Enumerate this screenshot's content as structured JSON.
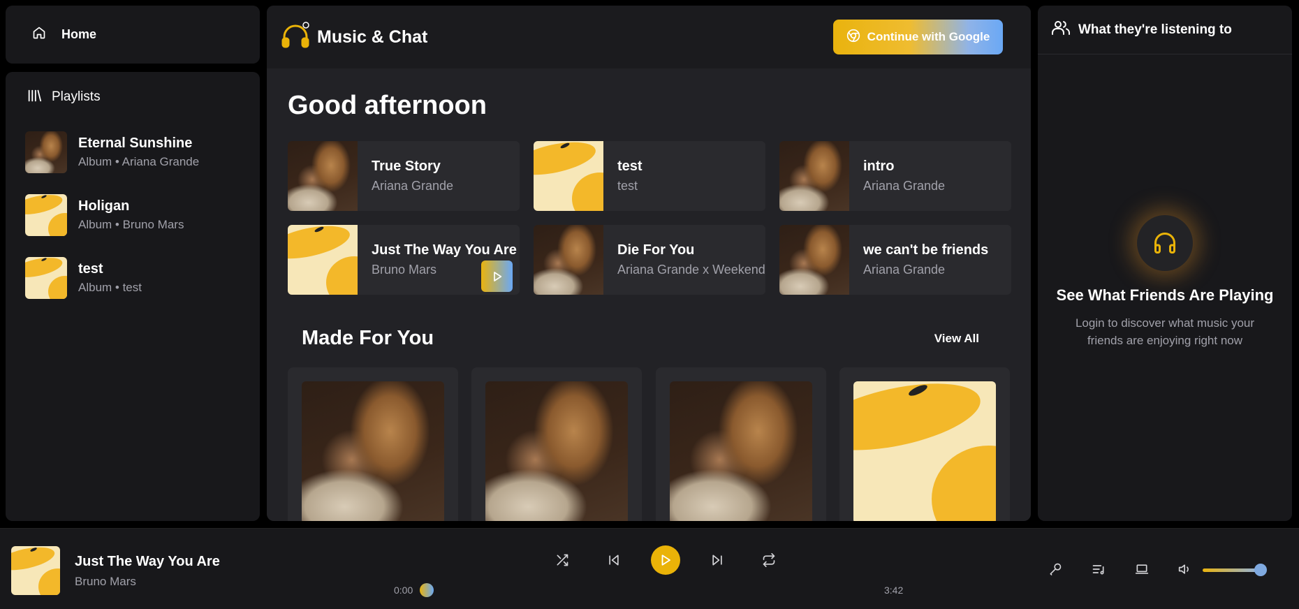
{
  "nav": {
    "home_label": "Home"
  },
  "library": {
    "title": "Playlists",
    "items": [
      {
        "name": "Eternal Sunshine",
        "sub": "Album • Ariana Grande",
        "art": "ariana"
      },
      {
        "name": "Holigan",
        "sub": "Album • Bruno Mars",
        "art": "bruno"
      },
      {
        "name": "test",
        "sub": "Album • test",
        "art": "bruno"
      }
    ]
  },
  "header": {
    "brand": "Music & Chat",
    "login_label": "Continue with Google"
  },
  "main": {
    "greeting": "Good afternoon",
    "quick": [
      {
        "title": "True Story",
        "artist": "Ariana Grande",
        "art": "ariana"
      },
      {
        "title": "test",
        "artist": "test",
        "art": "bruno"
      },
      {
        "title": "intro",
        "artist": "Ariana Grande",
        "art": "ariana"
      },
      {
        "title": "Just The Way You Are",
        "artist": "Bruno Mars",
        "art": "bruno"
      },
      {
        "title": "Die For You",
        "artist": "Ariana Grande x Weekend",
        "art": "ariana"
      },
      {
        "title": "we can't be friends",
        "artist": "Ariana Grande",
        "art": "ariana"
      }
    ],
    "made_for_you": {
      "title": "Made For You",
      "view_all": "View All"
    }
  },
  "friends": {
    "title": "What they're listening to",
    "empty_heading": "See What Friends Are Playing",
    "empty_line1": "Login to discover what music your",
    "empty_line2": "friends are enjoying right now"
  },
  "player": {
    "title": "Just The Way You Are",
    "artist": "Bruno Mars",
    "elapsed": "0:00",
    "duration": "3:42",
    "progress_fraction": 0.0,
    "volume_fraction": 0.9
  },
  "colors": {
    "accent": "#eab308",
    "accent_blue": "#6aa8f5",
    "panel": "#18181b"
  }
}
